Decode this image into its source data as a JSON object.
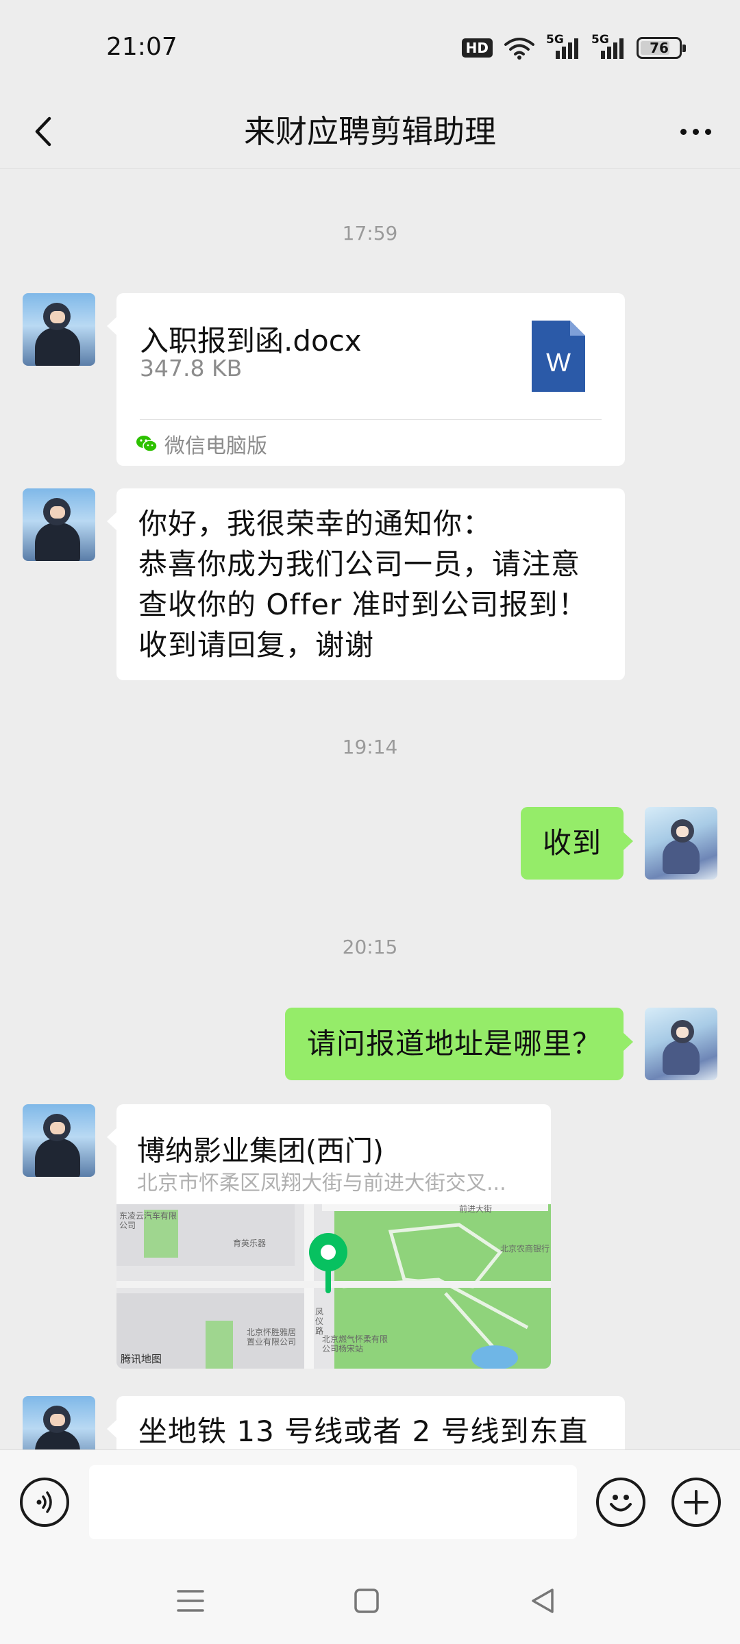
{
  "status_bar": {
    "time": "21:07",
    "hd": "HD",
    "net1": "5G",
    "net2": "5G",
    "battery": "76"
  },
  "header": {
    "title": "来财应聘剪辑助理"
  },
  "messages": {
    "ts1": "17:59",
    "file": {
      "name": "入职报到函.docx",
      "size": "347.8 KB",
      "source": "微信电脑版",
      "icon_letter": "W"
    },
    "offer": {
      "line1": "你好，我很荣幸的通知你：",
      "line2": "恭喜你成为我们公司一员，请注意",
      "line3": "查收你的 Offer 准时到公司报到！",
      "line4": "收到请回复，谢谢"
    },
    "ts2": "19:14",
    "reply1": "收到",
    "ts3": "20:15",
    "reply2": "请问报道地址是哪里？",
    "location": {
      "name": "博纳影业集团(西门)",
      "address": "北京市怀柔区凤翔大街与前进大街交叉...",
      "map_brand": "腾讯地图",
      "map_labels": [
        "东凌云汽车有限公司",
        "育英乐器",
        "前进大街",
        "北京农商银行",
        "凤仪路",
        "北京怀胜雅居置业有限公司",
        "北京燃气怀柔有限公司杨宋站"
      ]
    },
    "partial": "坐地铁 13 号线或者 2 号线到东直"
  },
  "colors": {
    "accent_green": "#95ec69",
    "background": "#ededed",
    "bubble": "#ffffff",
    "map_pin": "#07c160"
  },
  "icons": [
    "back-icon",
    "more-icon",
    "word-doc-icon",
    "wechat-icon",
    "map-pin-icon",
    "voice-icon",
    "emoji-icon",
    "plus-icon",
    "menu-icon",
    "home-icon",
    "back-triangle-icon"
  ]
}
